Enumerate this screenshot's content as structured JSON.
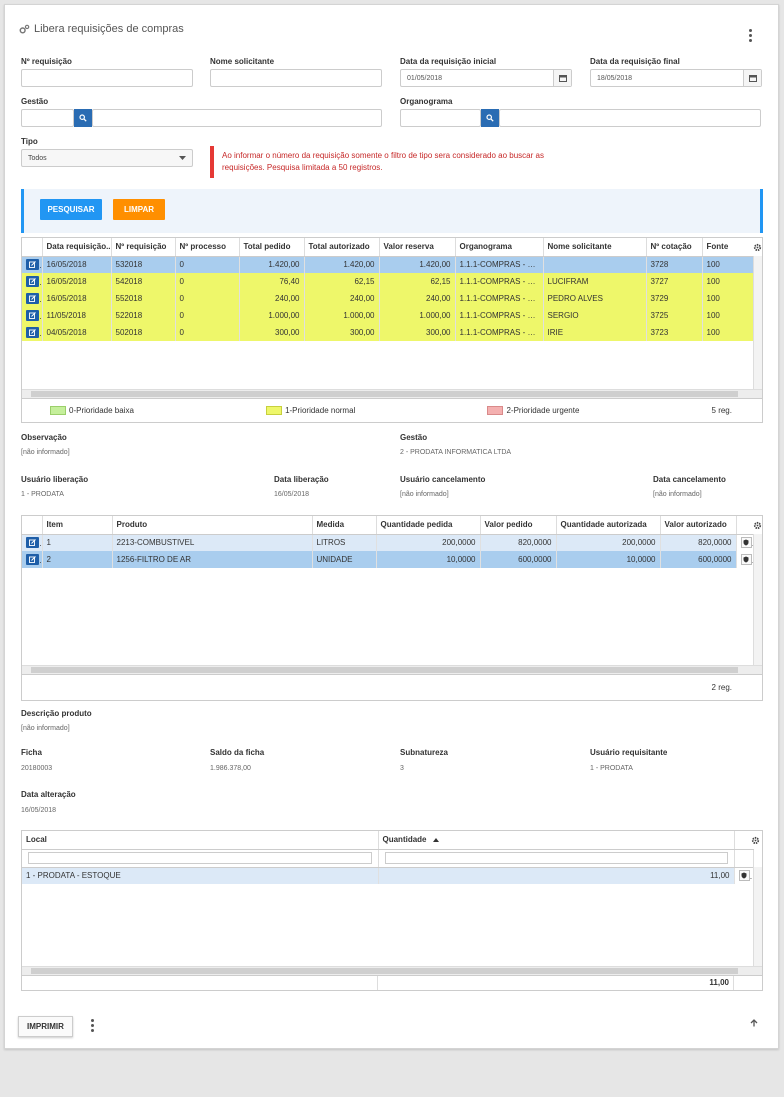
{
  "page": {
    "title": "Libera requisições de compras"
  },
  "filters": {
    "req_num_label": "Nº requisição",
    "req_num_value": "",
    "requester_label": "Nome solicitante",
    "requester_value": "",
    "date_start_label": "Data da requisição inicial",
    "date_start_value": "01/05/2018",
    "date_end_label": "Data da requisição final",
    "date_end_value": "18/05/2018",
    "gestao_label": "Gestão",
    "organograma_label": "Organograma",
    "tipo_label": "Tipo",
    "tipo_value": "Todos",
    "warning": "Ao informar o número da requisição somente o filtro de tipo sera considerado ao buscar as requisições. Pesquisa limitada a 50 registros."
  },
  "actions": {
    "search": "PESQUISAR",
    "clear": "LIMPAR",
    "print": "IMPRIMIR"
  },
  "colors": {
    "primary": "#2196f3",
    "orange": "#ff8f00",
    "edit": "#1e5ea8",
    "selected": "#a9cdee",
    "normal_priority": "#eef76a",
    "low_priority": "#c5ef9b",
    "urgent_priority": "#f4b0b0"
  },
  "requisitions": {
    "headers": [
      "Data requisição...",
      "Nº requisição",
      "Nº processo",
      "Total pedido",
      "Total autorizado",
      "Valor reserva",
      "Organograma",
      "Nome solicitante",
      "Nº cotação",
      "Fonte"
    ],
    "rows": [
      [
        "16/05/2018",
        "532018",
        "0",
        "1.420,00",
        "1.420,00",
        "1.420,00",
        "1.1.1-COMPRAS - SE...",
        "",
        "3728",
        "100"
      ],
      [
        "16/05/2018",
        "542018",
        "0",
        "76,40",
        "62,15",
        "62,15",
        "1.1.1-COMPRAS - SE...",
        "LUCIFRAM",
        "3727",
        "100"
      ],
      [
        "16/05/2018",
        "552018",
        "0",
        "240,00",
        "240,00",
        "240,00",
        "1.1.1-COMPRAS - SE...",
        "PEDRO ALVES",
        "3729",
        "100"
      ],
      [
        "11/05/2018",
        "522018",
        "0",
        "1.000,00",
        "1.000,00",
        "1.000,00",
        "1.1.1-COMPRAS - SE...",
        "SERGIO",
        "3725",
        "100"
      ],
      [
        "04/05/2018",
        "502018",
        "0",
        "300,00",
        "300,00",
        "300,00",
        "1.1.1-COMPRAS - SE...",
        "IRIE",
        "3723",
        "100"
      ]
    ],
    "legend": [
      "0-Prioridade baixa",
      "1-Prioridade normal",
      "2-Prioridade urgente"
    ],
    "count": "5 reg."
  },
  "details": {
    "obs_label": "Observação",
    "obs_value": "[não informado]",
    "gestao_label": "Gestão",
    "gestao_value": "2 - PRODATA INFORMATICA LTDA",
    "user_lib_label": "Usuário liberação",
    "user_lib_value": "1 - PRODATA",
    "date_lib_label": "Data liberação",
    "date_lib_value": "16/05/2018",
    "user_cancel_label": "Usuário cancelamento",
    "user_cancel_value": "[não informado]",
    "date_cancel_label": "Data cancelamento",
    "date_cancel_value": "[não informado]"
  },
  "items": {
    "headers": [
      "Item",
      "Produto",
      "Medida",
      "Quantidade pedida",
      "Valor pedido",
      "Quantidade autorizada",
      "Valor autorizado"
    ],
    "rows": [
      [
        "1",
        "2213-COMBUSTIVEL",
        "LITROS",
        "200,0000",
        "820,0000",
        "200,0000",
        "820,0000"
      ],
      [
        "2",
        "1256-FILTRO DE AR",
        "UNIDADE",
        "10,0000",
        "600,0000",
        "10,0000",
        "600,0000"
      ]
    ],
    "count": "2 reg."
  },
  "product": {
    "desc_label": "Descrição produto",
    "desc_value": "[não informado]",
    "ficha_label": "Ficha",
    "ficha_value": "20180003",
    "saldo_label": "Saldo da ficha",
    "saldo_value": "1.986.378,00",
    "subnat_label": "Subnatureza",
    "subnat_value": "3",
    "user_req_label": "Usuário requisitante",
    "user_req_value": "1 - PRODATA",
    "date_alt_label": "Data alteração",
    "date_alt_value": "16/05/2018"
  },
  "locations": {
    "headers": [
      "Local",
      "Quantidade"
    ],
    "rows": [
      [
        "1 - PRODATA - ESTOQUE",
        "11,00"
      ]
    ],
    "total": "11,00"
  }
}
